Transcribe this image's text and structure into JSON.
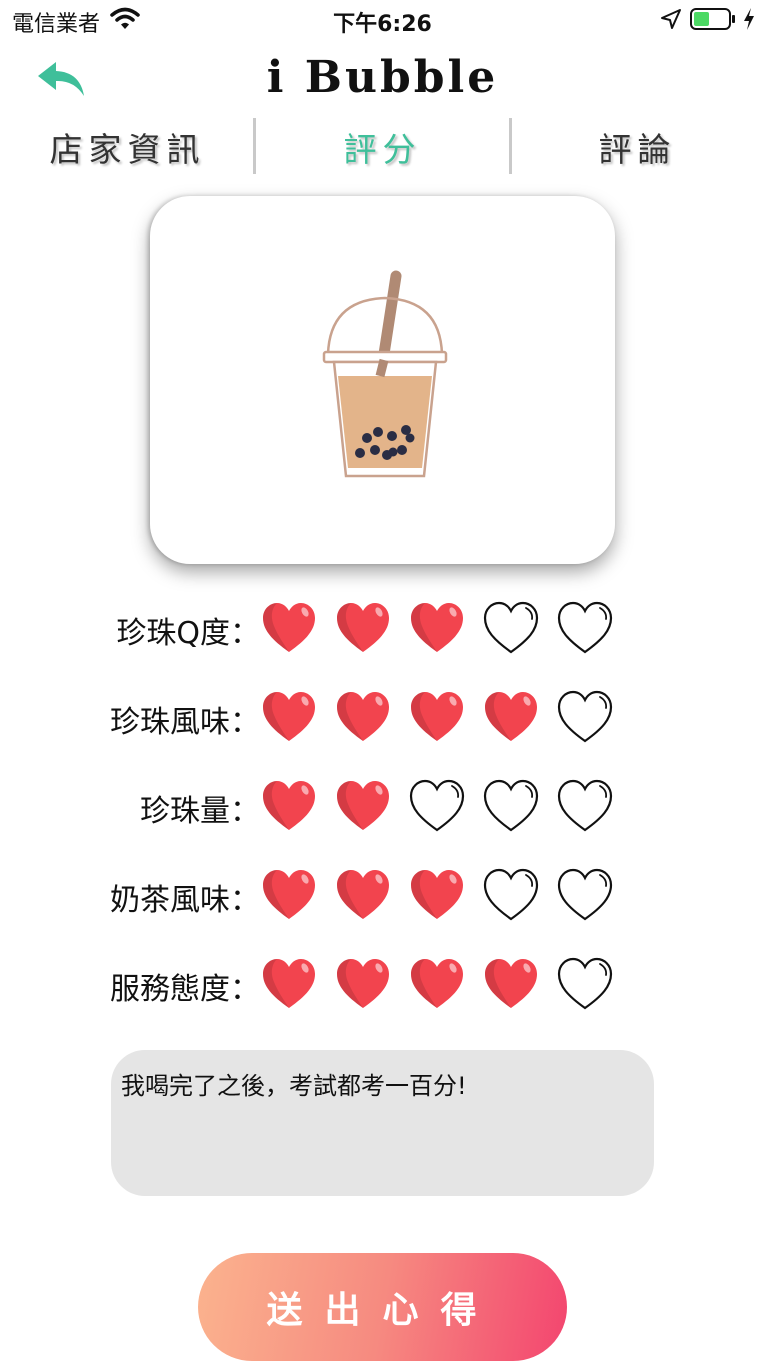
{
  "status_bar": {
    "carrier": "電信業者",
    "time": "下午6:26",
    "battery_color": "#4cd964"
  },
  "header": {
    "title": "i Bubble",
    "back_icon": "back-arrow-icon",
    "accent_color": "#3fbf9a"
  },
  "tabs": [
    {
      "label": "店家資訊",
      "active": false
    },
    {
      "label": "評分",
      "active": true
    },
    {
      "label": "評論",
      "active": false
    }
  ],
  "card": {
    "image_icon": "bubble-tea-icon"
  },
  "ratings": [
    {
      "label": "珍珠Q度：",
      "score": 3,
      "max": 5
    },
    {
      "label": "珍珠風味：",
      "score": 4,
      "max": 5
    },
    {
      "label": "珍珠量：",
      "score": 2,
      "max": 5
    },
    {
      "label": "奶茶風味：",
      "score": 3,
      "max": 5
    },
    {
      "label": "服務態度：",
      "score": 4,
      "max": 5
    }
  ],
  "heart_fill_color": "#f2444e",
  "comment": {
    "text": "我喝完了之後，考試都考一百分!"
  },
  "submit": {
    "label": "送出心得"
  }
}
